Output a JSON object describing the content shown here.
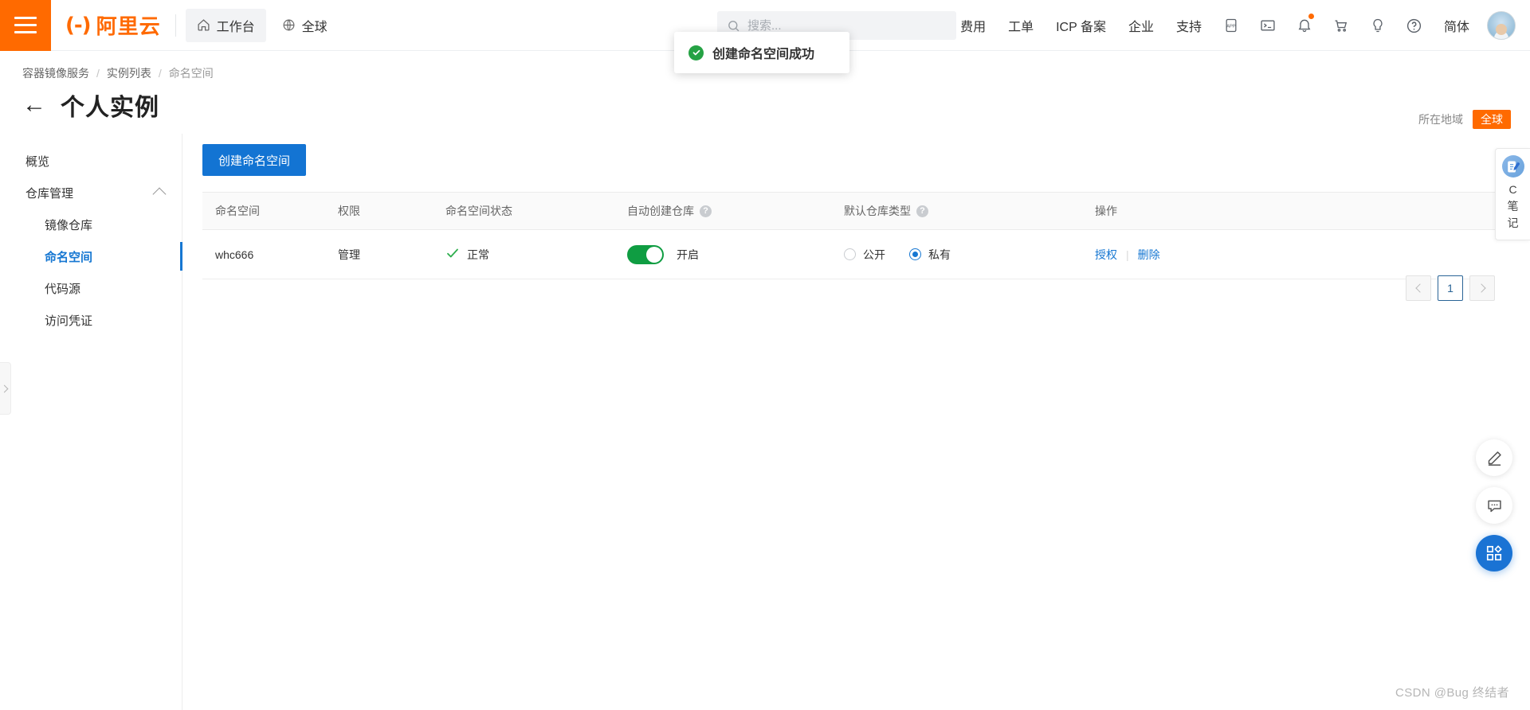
{
  "header": {
    "menu_icon": "hamburger-icon",
    "logo_mark": "(-)",
    "logo_text": "阿里云",
    "nav": [
      {
        "label": "工作台",
        "icon": "home-icon",
        "active": true
      },
      {
        "label": "全球",
        "icon": "globe-icon",
        "active": false
      }
    ],
    "search": {
      "placeholder": "搜索...",
      "value": "",
      "icon": "search-icon"
    },
    "links": [
      "费用",
      "工单",
      "ICP 备案",
      "企业",
      "支持"
    ],
    "icons": [
      "app-icon",
      "terminal-icon",
      "bell-icon",
      "cart-icon",
      "bulb-icon",
      "help-icon"
    ],
    "language": "简体",
    "avatar": "user-avatar"
  },
  "toast": {
    "message": "创建命名空间成功",
    "icon": "success-check-icon",
    "icon_color": "#25a244"
  },
  "breadcrumb": {
    "items": [
      "容器镜像服务",
      "实例列表",
      "命名空间"
    ],
    "separator": "/"
  },
  "page": {
    "back_arrow": "←",
    "title": "个人实例",
    "region_label": "所在地域",
    "region_value": "全球",
    "region_color": "#ff6a00"
  },
  "sidebar": {
    "items": [
      {
        "label": "概览",
        "level": 0,
        "active": false
      },
      {
        "label": "仓库管理",
        "level": 0,
        "active": false,
        "expandable": true,
        "expanded": true
      },
      {
        "label": "镜像仓库",
        "level": 1,
        "active": false
      },
      {
        "label": "命名空间",
        "level": 1,
        "active": true
      },
      {
        "label": "代码源",
        "level": 1,
        "active": false
      },
      {
        "label": "访问凭证",
        "level": 1,
        "active": false
      }
    ],
    "collapse_handle": "chevron-right-icon"
  },
  "main": {
    "create_button": "创建命名空间",
    "accent_color": "#1374d3",
    "columns": [
      "命名空间",
      "权限",
      "命名空间状态",
      "自动创建仓库",
      "默认仓库类型",
      "操作"
    ],
    "column_help": {
      "自动创建仓库": "?",
      "默认仓库类型": "?"
    },
    "rows": [
      {
        "namespace": "whc666",
        "permission": "管理",
        "status": "正常",
        "status_icon": "check-icon",
        "status_color": "#2eae4e",
        "auto_create": {
          "enabled": true,
          "label": "开启",
          "color": "#0f9d42"
        },
        "repo_type": {
          "options": [
            {
              "label": "公开",
              "selected": false
            },
            {
              "label": "私有",
              "selected": true
            }
          ]
        },
        "actions": [
          "授权",
          "删除"
        ],
        "action_separator": "|"
      }
    ]
  },
  "pagination": {
    "prev": "‹",
    "next": "›",
    "pages": [
      "1"
    ],
    "current": "1"
  },
  "note_widget": {
    "icon": "notepad-pen-icon",
    "letters": [
      "C",
      "笔",
      "记"
    ]
  },
  "fab": {
    "buttons": [
      {
        "icon": "pencil-icon",
        "primary": false
      },
      {
        "icon": "chat-bubble-icon",
        "primary": false
      },
      {
        "icon": "apps-grid-icon",
        "primary": true
      }
    ]
  },
  "watermark": "CSDN @Bug 终结者"
}
